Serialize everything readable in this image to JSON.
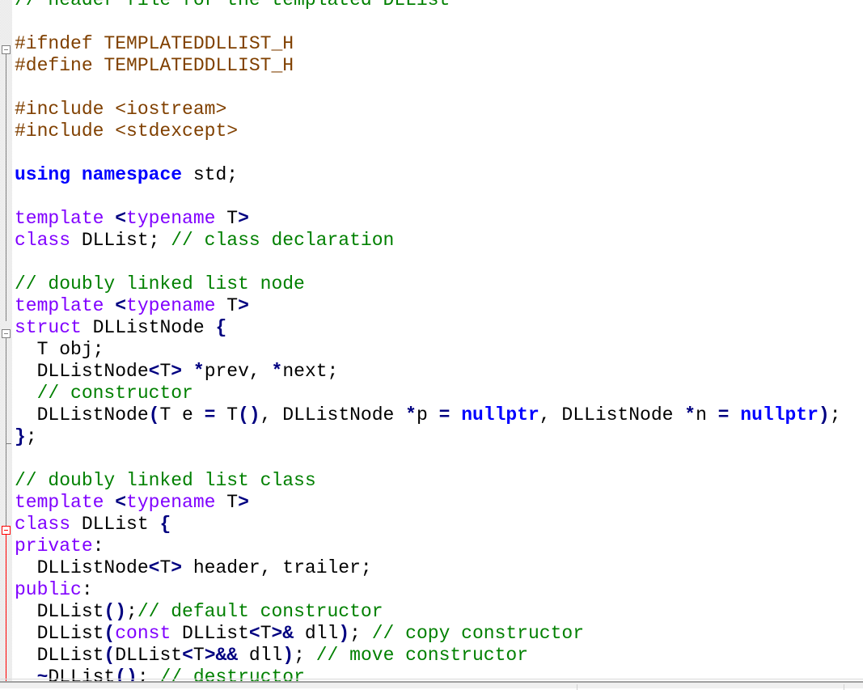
{
  "editor": {
    "language": "C++",
    "colors": {
      "comment": "#008000",
      "preprocessor": "#804000",
      "keyword": "#0000ff",
      "type": "#8000ff",
      "operator": "#000080",
      "fold_active": "#ff0000",
      "fold_inactive": "#808080"
    },
    "lines": [
      [
        {
          "c": "cm",
          "t": "// header file for the templated DLList"
        }
      ],
      [],
      [
        {
          "c": "pp",
          "t": "#ifndef TEMPLATEDDLLIST_H"
        }
      ],
      [
        {
          "c": "pp",
          "t": "#define TEMPLATEDDLLIST_H"
        }
      ],
      [],
      [
        {
          "c": "pp",
          "t": "#include <iostream>"
        }
      ],
      [
        {
          "c": "pp",
          "t": "#include <stdexcept>"
        }
      ],
      [],
      [
        {
          "c": "kw",
          "t": "using"
        },
        {
          "c": "tx",
          "t": " "
        },
        {
          "c": "kw",
          "t": "namespace"
        },
        {
          "c": "tx",
          "t": " std;"
        }
      ],
      [],
      [
        {
          "c": "ty",
          "t": "template"
        },
        {
          "c": "tx",
          "t": " "
        },
        {
          "c": "op",
          "t": "<"
        },
        {
          "c": "ty",
          "t": "typename"
        },
        {
          "c": "tx",
          "t": " T"
        },
        {
          "c": "op",
          "t": ">"
        }
      ],
      [
        {
          "c": "ty",
          "t": "class"
        },
        {
          "c": "tx",
          "t": " DLList; "
        },
        {
          "c": "cm",
          "t": "// class declaration"
        }
      ],
      [],
      [
        {
          "c": "cm",
          "t": "// doubly linked list node"
        }
      ],
      [
        {
          "c": "ty",
          "t": "template"
        },
        {
          "c": "tx",
          "t": " "
        },
        {
          "c": "op",
          "t": "<"
        },
        {
          "c": "ty",
          "t": "typename"
        },
        {
          "c": "tx",
          "t": " T"
        },
        {
          "c": "op",
          "t": ">"
        }
      ],
      [
        {
          "c": "ty",
          "t": "struct"
        },
        {
          "c": "tx",
          "t": " DLListNode "
        },
        {
          "c": "op",
          "t": "{"
        }
      ],
      [
        {
          "c": "tx",
          "t": "  T obj;"
        }
      ],
      [
        {
          "c": "tx",
          "t": "  DLListNode"
        },
        {
          "c": "op",
          "t": "<"
        },
        {
          "c": "tx",
          "t": "T"
        },
        {
          "c": "op",
          "t": ">"
        },
        {
          "c": "tx",
          "t": " "
        },
        {
          "c": "op",
          "t": "*"
        },
        {
          "c": "tx",
          "t": "prev, "
        },
        {
          "c": "op",
          "t": "*"
        },
        {
          "c": "tx",
          "t": "next;"
        }
      ],
      [
        {
          "c": "tx",
          "t": "  "
        },
        {
          "c": "cm",
          "t": "// constructor"
        }
      ],
      [
        {
          "c": "tx",
          "t": "  DLListNode"
        },
        {
          "c": "op",
          "t": "("
        },
        {
          "c": "tx",
          "t": "T e "
        },
        {
          "c": "op",
          "t": "="
        },
        {
          "c": "tx",
          "t": " T"
        },
        {
          "c": "op",
          "t": "()"
        },
        {
          "c": "tx",
          "t": ", DLListNode "
        },
        {
          "c": "op",
          "t": "*"
        },
        {
          "c": "tx",
          "t": "p "
        },
        {
          "c": "op",
          "t": "="
        },
        {
          "c": "tx",
          "t": " "
        },
        {
          "c": "kw",
          "t": "nullptr"
        },
        {
          "c": "tx",
          "t": ", DLListNode "
        },
        {
          "c": "op",
          "t": "*"
        },
        {
          "c": "tx",
          "t": "n "
        },
        {
          "c": "op",
          "t": "="
        },
        {
          "c": "tx",
          "t": " "
        },
        {
          "c": "kw",
          "t": "nullptr"
        },
        {
          "c": "op",
          "t": ")"
        },
        {
          "c": "tx",
          "t": ";"
        }
      ],
      [
        {
          "c": "op",
          "t": "}"
        },
        {
          "c": "tx",
          "t": ";"
        }
      ],
      [],
      [
        {
          "c": "cm",
          "t": "// doubly linked list class"
        }
      ],
      [
        {
          "c": "ty",
          "t": "template"
        },
        {
          "c": "tx",
          "t": " "
        },
        {
          "c": "op",
          "t": "<"
        },
        {
          "c": "ty",
          "t": "typename"
        },
        {
          "c": "tx",
          "t": " T"
        },
        {
          "c": "op",
          "t": ">"
        }
      ],
      [
        {
          "c": "ty",
          "t": "class"
        },
        {
          "c": "tx",
          "t": " DLList "
        },
        {
          "c": "op",
          "t": "{"
        }
      ],
      [
        {
          "c": "ty",
          "t": "private"
        },
        {
          "c": "tx",
          "t": ":"
        }
      ],
      [
        {
          "c": "tx",
          "t": "  DLListNode"
        },
        {
          "c": "op",
          "t": "<"
        },
        {
          "c": "tx",
          "t": "T"
        },
        {
          "c": "op",
          "t": ">"
        },
        {
          "c": "tx",
          "t": " header, trailer;"
        }
      ],
      [
        {
          "c": "ty",
          "t": "public"
        },
        {
          "c": "tx",
          "t": ":"
        }
      ],
      [
        {
          "c": "tx",
          "t": "  DLList"
        },
        {
          "c": "op",
          "t": "()"
        },
        {
          "c": "tx",
          "t": ";"
        },
        {
          "c": "cm",
          "t": "// default constructor"
        }
      ],
      [
        {
          "c": "tx",
          "t": "  DLList"
        },
        {
          "c": "op",
          "t": "("
        },
        {
          "c": "ty",
          "t": "const"
        },
        {
          "c": "tx",
          "t": " DLList"
        },
        {
          "c": "op",
          "t": "<"
        },
        {
          "c": "tx",
          "t": "T"
        },
        {
          "c": "op",
          "t": ">&"
        },
        {
          "c": "tx",
          "t": " dll"
        },
        {
          "c": "op",
          "t": ")"
        },
        {
          "c": "tx",
          "t": "; "
        },
        {
          "c": "cm",
          "t": "// copy constructor"
        }
      ],
      [
        {
          "c": "tx",
          "t": "  DLList"
        },
        {
          "c": "op",
          "t": "("
        },
        {
          "c": "tx",
          "t": "DLList"
        },
        {
          "c": "op",
          "t": "<"
        },
        {
          "c": "tx",
          "t": "T"
        },
        {
          "c": "op",
          "t": ">&&"
        },
        {
          "c": "tx",
          "t": " dll"
        },
        {
          "c": "op",
          "t": ")"
        },
        {
          "c": "tx",
          "t": "; "
        },
        {
          "c": "cm",
          "t": "// move constructor"
        }
      ],
      [
        {
          "c": "tx",
          "t": "  "
        },
        {
          "c": "op",
          "t": "~"
        },
        {
          "c": "tx",
          "t": "DLList"
        },
        {
          "c": "op",
          "t": "()"
        },
        {
          "c": "tx",
          "t": "; "
        },
        {
          "c": "cm",
          "t": "// destructor"
        }
      ]
    ]
  },
  "statusbar": {}
}
